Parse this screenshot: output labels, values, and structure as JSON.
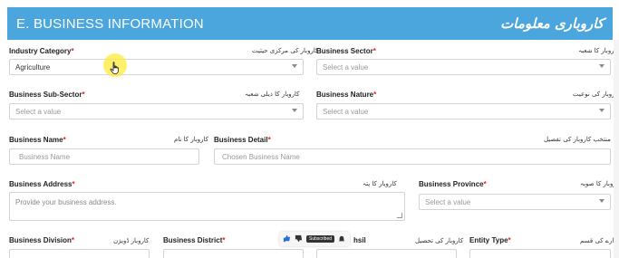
{
  "header": {
    "title": "E. BUSINESS INFORMATION",
    "title_urdu": "کاروباری معلومات"
  },
  "required_marker": "*",
  "fields": {
    "industry_category": {
      "label": "Industry Category",
      "label_urdu": "کاروبار کی مرکزی حیثیت",
      "value": "Agriculture"
    },
    "business_sector": {
      "label": "Business Sector",
      "label_urdu": "کاروبار کا شعبہ",
      "placeholder": "Select a value"
    },
    "business_sub_sector": {
      "label": "Business Sub-Sector",
      "label_urdu": "کاروبار کا ذیلی شعبہ",
      "placeholder": "Select a value"
    },
    "business_nature": {
      "label": "Business Nature",
      "label_urdu": "کاروبار کی نوعیت",
      "placeholder": "Select a value"
    },
    "business_name": {
      "label": "Business Name",
      "label_urdu": "کاروبار کا نام",
      "placeholder": "Business Name"
    },
    "business_detail": {
      "label": "Business Detail",
      "label_urdu": "منتخب کاروبار کی تفصیل",
      "placeholder": "Chosen Business Name"
    },
    "business_address": {
      "label": "Business Address",
      "label_urdu": "کاروبار کا پتہ",
      "placeholder": "Provide your business address."
    },
    "business_province": {
      "label": "Business Province",
      "label_urdu": "کاروبار کا صوبہ",
      "placeholder": "Select a value"
    },
    "business_division": {
      "label": "Business Division",
      "label_urdu": "کاروبار ڈویژن"
    },
    "business_district": {
      "label": "Business District"
    },
    "business_tehsil": {
      "label": "hsil",
      "label_urdu": "کاروبار کی تحصیل"
    },
    "entity_type": {
      "label": "Entity Type",
      "label_urdu": "ادارے کی قسم"
    }
  },
  "overlay": {
    "subscribed": "Subscribed"
  },
  "colors": {
    "header": "#4aa6dc",
    "required": "#e02020",
    "highlight": "#ffeb3b"
  },
  "icons": [
    "thumbs-up-icon",
    "thumbs-down-icon",
    "bell-icon",
    "pointer-hand-icon",
    "dropdown-caret-icon"
  ]
}
